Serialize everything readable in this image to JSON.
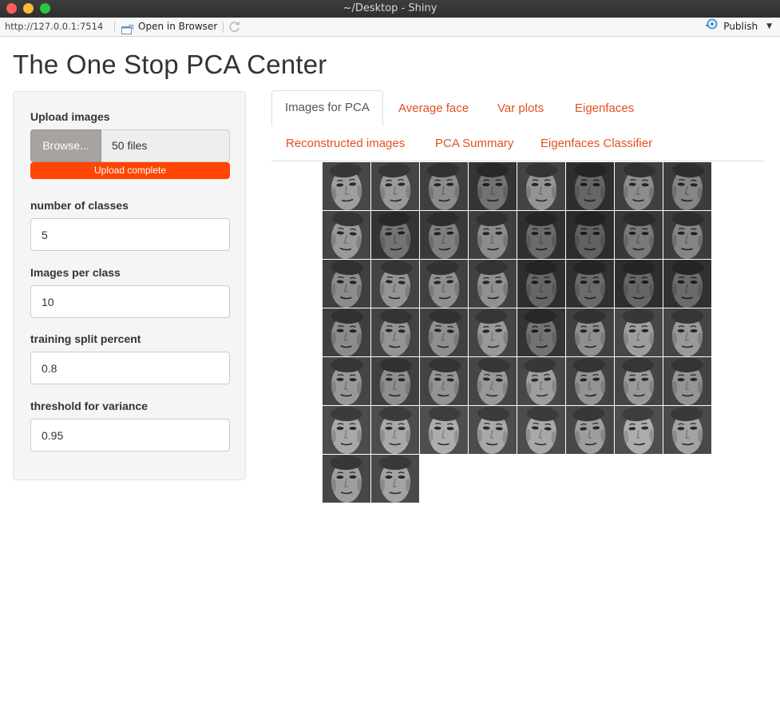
{
  "window": {
    "title": "~/Desktop - Shiny"
  },
  "toolbar": {
    "url": "http://127.0.0.1:7514",
    "open_in_browser": "Open in Browser",
    "publish": "Publish",
    "open_icon": "browser-window-icon",
    "refresh_icon": "refresh-icon",
    "publish_icon": "publish-icon"
  },
  "app": {
    "title": "The One Stop PCA Center"
  },
  "sidebar": {
    "upload": {
      "label": "Upload images",
      "browse_label": "Browse...",
      "file_status": "50 files",
      "progress_text": "Upload complete",
      "progress_fraction": 1.0,
      "progress_color": "#ff4500"
    },
    "inputs": [
      {
        "label": "number of classes",
        "value": "5"
      },
      {
        "label": "Images per class",
        "value": "10"
      },
      {
        "label": "training split percent",
        "value": "0.8"
      },
      {
        "label": "threshold for variance",
        "value": "0.95"
      }
    ]
  },
  "tabs": [
    {
      "label": "Images for PCA",
      "active": true
    },
    {
      "label": "Average face",
      "active": false
    },
    {
      "label": "Var plots",
      "active": false
    },
    {
      "label": "Eigenfaces",
      "active": false
    },
    {
      "label": "Reconstructed images",
      "active": false
    },
    {
      "label": "PCA Summary",
      "active": false
    },
    {
      "label": "Eigenfaces Classifier",
      "active": false
    }
  ],
  "colors": {
    "accent": "#e3501e",
    "tab_active_text": "#555555"
  },
  "faces": {
    "count": 50,
    "per_row": 8,
    "brightness": [
      0.62,
      0.6,
      0.55,
      0.45,
      0.58,
      0.4,
      0.55,
      0.52,
      0.6,
      0.45,
      0.5,
      0.55,
      0.42,
      0.38,
      0.48,
      0.52,
      0.55,
      0.58,
      0.56,
      0.57,
      0.4,
      0.42,
      0.4,
      0.42,
      0.55,
      0.58,
      0.56,
      0.6,
      0.45,
      0.56,
      0.62,
      0.6,
      0.6,
      0.56,
      0.58,
      0.6,
      0.62,
      0.58,
      0.6,
      0.58,
      0.66,
      0.66,
      0.68,
      0.66,
      0.66,
      0.62,
      0.68,
      0.64,
      0.62,
      0.64
    ]
  }
}
